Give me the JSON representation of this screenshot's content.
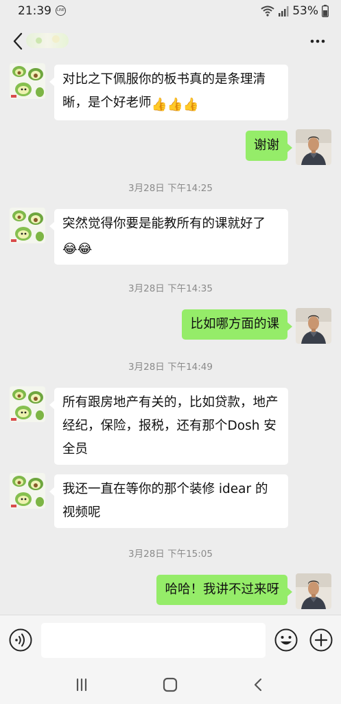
{
  "status_bar": {
    "time": "21:39",
    "line_icon_text": "LINE",
    "battery": "53%"
  },
  "header": {
    "back_icon": "chevron-left-icon",
    "more_icon": "more-dots-icon"
  },
  "messages": [
    {
      "side": "left",
      "text": "对比之下佩服你的板书真的是条理清晰，是个好老师",
      "emoji": "👍👍👍"
    },
    {
      "side": "right",
      "text": "谢谢"
    },
    {
      "timestamp": "3月28日 下午14:25"
    },
    {
      "side": "left",
      "text": "突然觉得你要是能教所有的课就好了",
      "emoji": "😂😂"
    },
    {
      "timestamp": "3月28日 下午14:35"
    },
    {
      "side": "right",
      "text": "比如哪方面的课"
    },
    {
      "timestamp": "3月28日 下午14:49"
    },
    {
      "side": "left",
      "text": "所有跟房地产有关的，比如贷款，地产经纪，保险，报税，还有那个Dosh 安全员"
    },
    {
      "side": "left",
      "text": "我还一直在等你的那个装修 idear 的视频呢"
    },
    {
      "timestamp": "3月28日 下午15:05"
    },
    {
      "side": "right",
      "text": "哈哈！我讲不过来呀"
    }
  ],
  "input_bar": {
    "placeholder": "",
    "icons": [
      "voice-icon",
      "emoji-icon",
      "plus-icon"
    ]
  },
  "nav_bar": {
    "icons": [
      "recents-icon",
      "home-icon",
      "back-icon"
    ]
  },
  "colors": {
    "background": "#ededed",
    "outgoing_bubble": "#95ec69",
    "incoming_bubble": "#ffffff"
  }
}
